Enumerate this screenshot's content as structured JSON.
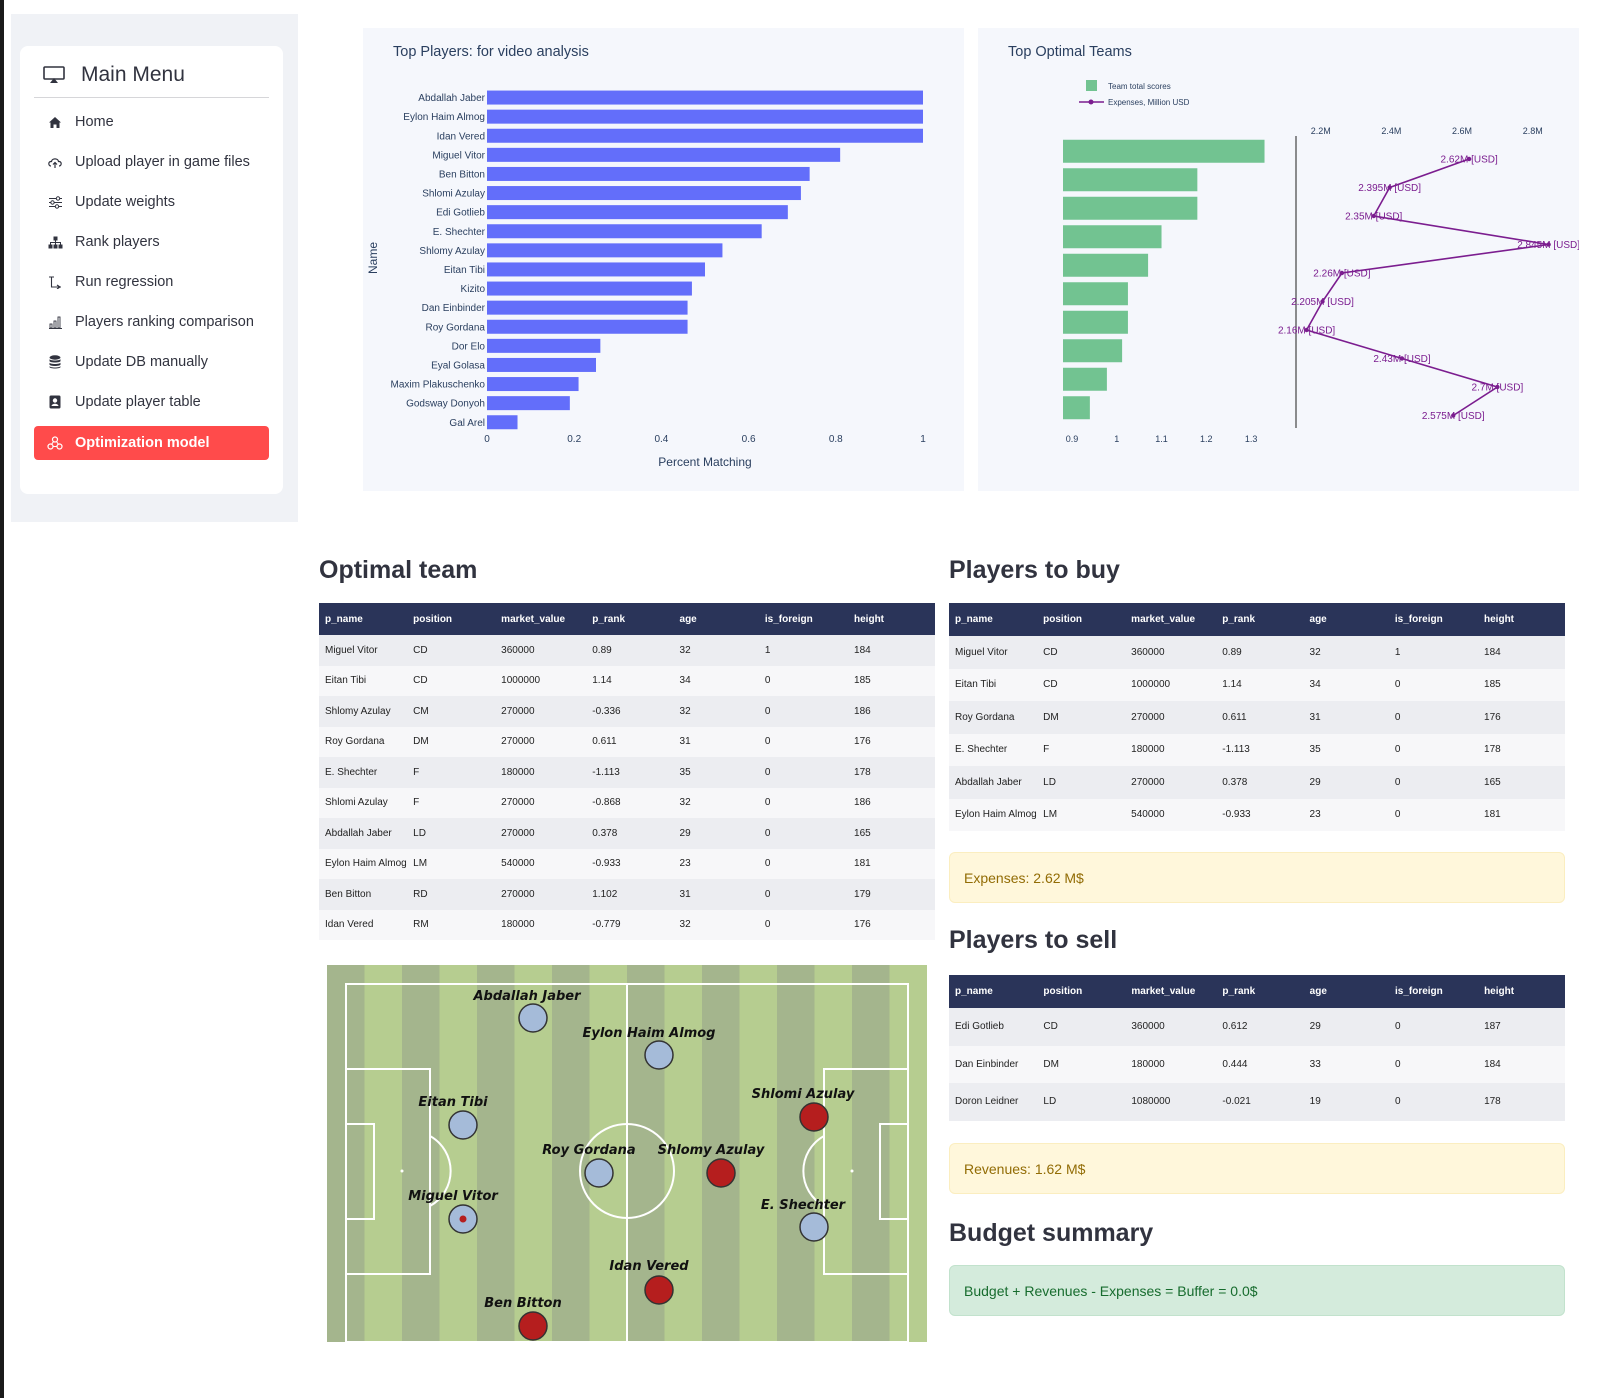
{
  "sidebar": {
    "title": "Main Menu",
    "items": [
      {
        "label": "Home",
        "icon": "house-icon"
      },
      {
        "label": "Upload player in game files",
        "icon": "cloud-upload-icon"
      },
      {
        "label": "Update weights",
        "icon": "sliders-icon"
      },
      {
        "label": "Rank players",
        "icon": "diagram-icon"
      },
      {
        "label": "Run regression",
        "icon": "regression-icon"
      },
      {
        "label": "Players ranking comparison",
        "icon": "bar-chart-icon"
      },
      {
        "label": "Update DB manually",
        "icon": "database-icon"
      },
      {
        "label": "Update player table",
        "icon": "person-badge-icon"
      },
      {
        "label": "Optimization model",
        "icon": "optimization-icon",
        "active": true
      }
    ],
    "active_color": "#ff4b4b"
  },
  "chart_data": [
    {
      "type": "bar",
      "orientation": "horizontal",
      "title": "Top Players: for video analysis",
      "xlabel": "Percent Matching",
      "ylabel": "Name",
      "xlim": [
        0,
        1
      ],
      "xticks": [
        "0",
        "0.2",
        "0.4",
        "0.6",
        "0.8",
        "1"
      ],
      "color": "#636efa",
      "categories": [
        "Abdallah Jaber",
        "Eylon Haim Almog",
        "Idan Vered",
        "Miguel Vitor",
        "Ben Bitton",
        "Shlomi Azulay",
        "Edi Gotlieb",
        "E. Shechter",
        "Shlomy Azulay",
        "Eitan Tibi",
        "Kizito",
        "Dan Einbinder",
        "Roy Gordana",
        "Dor Elo",
        "Eyal Golasa",
        "Maxim Plakuschenko",
        "Godsway Donyoh",
        "Gal Arel"
      ],
      "values": [
        1.0,
        1.0,
        1.0,
        0.81,
        0.74,
        0.72,
        0.69,
        0.63,
        0.54,
        0.5,
        0.47,
        0.46,
        0.46,
        0.26,
        0.25,
        0.21,
        0.19,
        0.07
      ]
    },
    {
      "type": "bar+line",
      "title": "Top Optimal Teams",
      "legend": [
        "Team total scores",
        "Expenses, Million USD"
      ],
      "legend_position": "top-left",
      "bar_color": "#72c391",
      "line_color": "#7b1d8f",
      "bar_xlim": [
        0.88,
        1.34
      ],
      "bar_xticks": [
        "0.9",
        "1",
        "1.1",
        "1.2",
        "1.3"
      ],
      "bar_values": [
        1.33,
        1.18,
        1.18,
        1.1,
        1.07,
        1.025,
        1.025,
        1.012,
        0.978,
        0.94
      ],
      "line_xlim": [
        2.13,
        2.88
      ],
      "line_xticks": [
        "2.2M",
        "2.4M",
        "2.6M",
        "2.8M"
      ],
      "line_values": [
        2.62,
        2.395,
        2.35,
        2.845,
        2.26,
        2.205,
        2.16,
        2.43,
        2.7,
        2.575
      ],
      "line_labels": [
        "2.62M [USD]",
        "2.395M [USD]",
        "2.35M [USD]",
        "2.845M [USD]",
        "2.26M [USD]",
        "2.205M [USD]",
        "2.16M [USD]",
        "2.43M [USD]",
        "2.7M [USD]",
        "2.575M [USD]"
      ]
    }
  ],
  "optimal_team": {
    "title": "Optimal team",
    "columns": [
      "p_name",
      "position",
      "market_value",
      "p_rank",
      "age",
      "is_foreign",
      "height"
    ],
    "rows": [
      [
        "Miguel Vitor",
        "CD",
        "360000",
        "0.89",
        "32",
        "1",
        "184"
      ],
      [
        "Eitan Tibi",
        "CD",
        "1000000",
        "1.14",
        "34",
        "0",
        "185"
      ],
      [
        "Shlomy Azulay",
        "CM",
        "270000",
        "-0.336",
        "32",
        "0",
        "186"
      ],
      [
        "Roy Gordana",
        "DM",
        "270000",
        "0.611",
        "31",
        "0",
        "176"
      ],
      [
        "E. Shechter",
        "F",
        "180000",
        "-1.113",
        "35",
        "0",
        "178"
      ],
      [
        "Shlomi Azulay",
        "F",
        "270000",
        "-0.868",
        "32",
        "0",
        "186"
      ],
      [
        "Abdallah Jaber",
        "LD",
        "270000",
        "0.378",
        "29",
        "0",
        "165"
      ],
      [
        "Eylon Haim Almog",
        "LM",
        "540000",
        "-0.933",
        "23",
        "0",
        "181"
      ],
      [
        "Ben Bitton",
        "RD",
        "270000",
        "1.102",
        "31",
        "0",
        "179"
      ],
      [
        "Idan Vered",
        "RM",
        "180000",
        "-0.779",
        "32",
        "0",
        "176"
      ]
    ]
  },
  "players_to_buy": {
    "title": "Players to buy",
    "columns": [
      "p_name",
      "position",
      "market_value",
      "p_rank",
      "age",
      "is_foreign",
      "height"
    ],
    "rows": [
      [
        "Miguel Vitor",
        "CD",
        "360000",
        "0.89",
        "32",
        "1",
        "184"
      ],
      [
        "Eitan Tibi",
        "CD",
        "1000000",
        "1.14",
        "34",
        "0",
        "185"
      ],
      [
        "Roy Gordana",
        "DM",
        "270000",
        "0.611",
        "31",
        "0",
        "176"
      ],
      [
        "E. Shechter",
        "F",
        "180000",
        "-1.113",
        "35",
        "0",
        "178"
      ],
      [
        "Abdallah Jaber",
        "LD",
        "270000",
        "0.378",
        "29",
        "0",
        "165"
      ],
      [
        "Eylon Haim Almog",
        "LM",
        "540000",
        "-0.933",
        "23",
        "0",
        "181"
      ]
    ],
    "expenses": "Expenses: 2.62 M$"
  },
  "players_to_sell": {
    "title": "Players to sell",
    "columns": [
      "p_name",
      "position",
      "market_value",
      "p_rank",
      "age",
      "is_foreign",
      "height"
    ],
    "rows": [
      [
        "Edi Gotlieb",
        "CD",
        "360000",
        "0.612",
        "29",
        "0",
        "187"
      ],
      [
        "Dan Einbinder",
        "DM",
        "180000",
        "0.444",
        "33",
        "0",
        "184"
      ],
      [
        "Doron Leidner",
        "LD",
        "1080000",
        "-0.021",
        "19",
        "0",
        "178"
      ]
    ],
    "revenues": "Revenues: 1.62 M$"
  },
  "budget_summary": {
    "title": "Budget summary",
    "text": "Budget + Revenues - Expenses = Buffer = 0.0$"
  },
  "pitch": {
    "players": [
      {
        "name": "Abdallah Jaber",
        "color": "blue"
      },
      {
        "name": "Eylon Haim Almog",
        "color": "blue"
      },
      {
        "name": "Eitan Tibi",
        "color": "blue"
      },
      {
        "name": "Shlomi Azulay",
        "color": "red"
      },
      {
        "name": "Roy Gordana",
        "color": "blue"
      },
      {
        "name": "Shlomy Azulay",
        "color": "red"
      },
      {
        "name": "Miguel Vitor",
        "color": "blue"
      },
      {
        "name": "E. Shechter",
        "color": "blue"
      },
      {
        "name": "Idan Vered",
        "color": "red"
      },
      {
        "name": "Ben Bitton",
        "color": "red"
      }
    ]
  }
}
